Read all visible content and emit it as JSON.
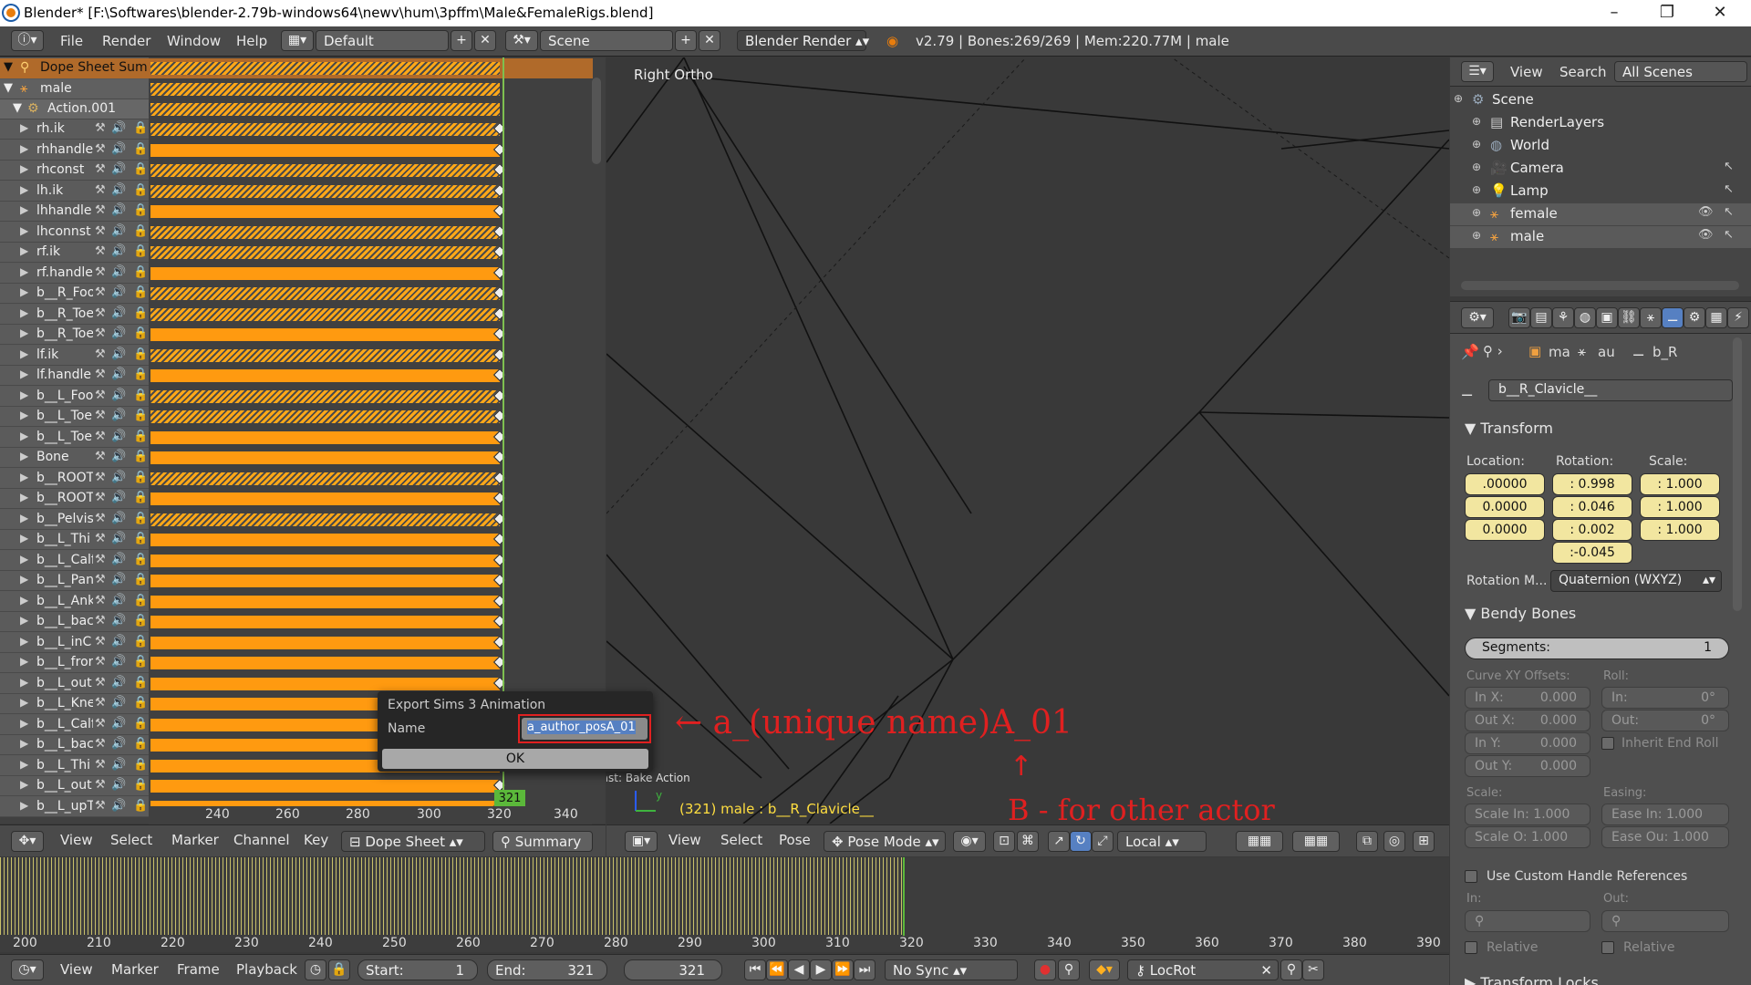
{
  "titlebar": {
    "title": "Blender* [F:\\Softwares\\blender-2.79b-windows64\\newv\\hum\\3pffm\\Male&FemaleRigs.blend]",
    "minimize": "–",
    "restore": "❐",
    "close": "✕"
  },
  "infobar": {
    "menus": [
      "File",
      "Render",
      "Window",
      "Help"
    ],
    "layout": "Default",
    "scene": "Scene",
    "engine": "Blender Render",
    "stats": "v2.79 | Bones:269/269 | Mem:220.77M | male"
  },
  "dopesheet": {
    "summary": "Dope Sheet Summ",
    "object": "male",
    "action": "Action.001",
    "channels": [
      {
        "name": "rh.ik",
        "stripe": true
      },
      {
        "name": "rhhandle",
        "stripe": false
      },
      {
        "name": "rhconst",
        "stripe": true
      },
      {
        "name": "lh.ik",
        "stripe": true
      },
      {
        "name": "lhhandle",
        "stripe": false
      },
      {
        "name": "lhconnst",
        "stripe": true
      },
      {
        "name": "rf.ik",
        "stripe": true
      },
      {
        "name": "rf.handle",
        "stripe": false
      },
      {
        "name": "b__R_Foo",
        "stripe": true
      },
      {
        "name": "b__R_Toe",
        "stripe": true
      },
      {
        "name": "b__R_Toe",
        "stripe": false
      },
      {
        "name": "lf.ik",
        "stripe": true
      },
      {
        "name": "lf.handle",
        "stripe": false
      },
      {
        "name": "b__L_Foo",
        "stripe": true
      },
      {
        "name": "b__L_Toe",
        "stripe": true
      },
      {
        "name": "b__L_Toe",
        "stripe": false
      },
      {
        "name": "Bone",
        "stripe": false
      },
      {
        "name": "b__ROOT",
        "stripe": true
      },
      {
        "name": "b__ROOT",
        "stripe": false
      },
      {
        "name": "b__Pelvis",
        "stripe": true
      },
      {
        "name": "b__L_Thi",
        "stripe": false
      },
      {
        "name": "b__L_Calf",
        "stripe": false
      },
      {
        "name": "b__L_Pan",
        "stripe": false
      },
      {
        "name": "b__L_Ank",
        "stripe": false
      },
      {
        "name": "b__L_bac",
        "stripe": false
      },
      {
        "name": "b__L_inC",
        "stripe": false
      },
      {
        "name": "b__L_fror",
        "stripe": false
      },
      {
        "name": "b__L_out",
        "stripe": false
      },
      {
        "name": "b__L_Kne",
        "stripe": false
      },
      {
        "name": "b__L_Calf",
        "stripe": false
      },
      {
        "name": "b__L_bac",
        "stripe": false
      },
      {
        "name": "b__L_Thi",
        "stripe": false
      },
      {
        "name": "b__L_out",
        "stripe": false
      },
      {
        "name": "b__L_upT",
        "stripe": false
      }
    ],
    "ruler": [
      "240",
      "260",
      "280",
      "300",
      "320",
      "340"
    ],
    "current_frame": "321",
    "footer": {
      "menus": [
        "View",
        "Select",
        "Marker",
        "Channel",
        "Key"
      ],
      "mode": "Dope Sheet",
      "summary": "Summary"
    }
  },
  "dialog": {
    "title": "Export Sims 3 Animation",
    "name_label": "Name",
    "name_value": "a_author_posA_01",
    "ok": "OK"
  },
  "viewport": {
    "label": "Right Ortho",
    "status": "(321) male : b__R_Clavicle__",
    "last_op": "Last: Bake Action",
    "axis_y": "y",
    "annotation1": "← a_(unique name)A_01",
    "annotation2": "B - for other actor",
    "arrow": "↑",
    "footer": {
      "menus": [
        "View",
        "Select",
        "Pose"
      ],
      "mode": "Pose Mode",
      "orientation": "Local"
    }
  },
  "timeline": {
    "ruler": [
      "200",
      "210",
      "220",
      "230",
      "240",
      "250",
      "260",
      "270",
      "280",
      "290",
      "300",
      "310",
      "320",
      "330",
      "340",
      "350",
      "360",
      "370",
      "380",
      "390"
    ],
    "footer": {
      "menus": [
        "View",
        "Marker",
        "Frame",
        "Playback"
      ],
      "start_label": "Start:",
      "start": "1",
      "end_label": "End:",
      "end": "321",
      "current": "321",
      "sync": "No Sync",
      "keying": "LocRot"
    }
  },
  "outliner": {
    "header": {
      "view": "View",
      "search": "Search",
      "scope": "All Scenes"
    },
    "items": [
      {
        "name": "Scene",
        "indent": 0
      },
      {
        "name": "RenderLayers",
        "indent": 1
      },
      {
        "name": "World",
        "indent": 1
      },
      {
        "name": "Camera",
        "indent": 1
      },
      {
        "name": "Lamp",
        "indent": 1
      },
      {
        "name": "female",
        "indent": 1
      },
      {
        "name": "male",
        "indent": 1
      }
    ]
  },
  "properties": {
    "breadcrumb": [
      "ma",
      "au",
      "b_R"
    ],
    "bone_name": "b__R_Clavicle__",
    "transform": {
      "title": "Transform",
      "location_label": "Location:",
      "rotation_label": "Rotation:",
      "scale_label": "Scale:",
      "location": [
        ".00000",
        "0.0000",
        "0.0000"
      ],
      "rotation": [
        ": 0.998",
        ": 0.046",
        ": 0.002",
        ":-0.045"
      ],
      "scale": [
        ": 1.000",
        ": 1.000",
        ": 1.000"
      ],
      "rotation_mode_label": "Rotation M...",
      "rotation_mode": "Quaternion (WXYZ)"
    },
    "bendy": {
      "title": "Bendy Bones",
      "segments_label": "Segments:",
      "segments": "1",
      "curve_label": "Curve XY Offsets:",
      "roll_label": "Roll:",
      "in_x": "In X:",
      "in_x_v": "0.000",
      "out_x": "Out X:",
      "out_x_v": "0.000",
      "in_y": "In Y:",
      "in_y_v": "0.000",
      "out_y": "Out Y:",
      "out_y_v": "0.000",
      "roll_in": "In:",
      "roll_in_v": "0°",
      "roll_out": "Out:",
      "roll_out_v": "0°",
      "inherit": "Inherit End Roll",
      "scale_label": "Scale:",
      "easing_label": "Easing:",
      "scale_in": "Scale In: 1.000",
      "scale_out": "Scale O: 1.000",
      "ease_in": "Ease In: 1.000",
      "ease_out": "Ease Ou: 1.000",
      "custom": "Use Custom Handle References",
      "in": "In:",
      "out": "Out:",
      "relative": "Relative"
    },
    "transform_locks": "Transform Locks"
  }
}
